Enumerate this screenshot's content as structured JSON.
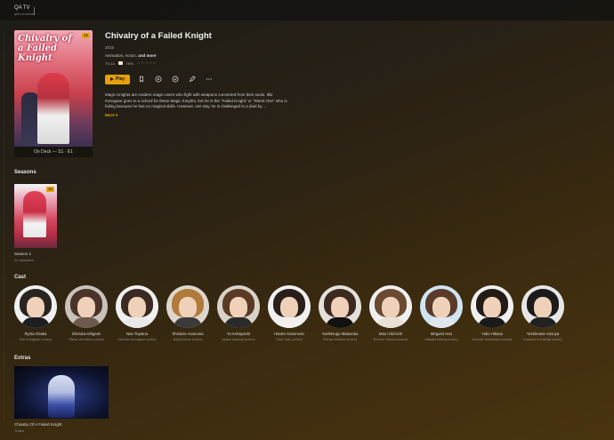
{
  "topbar": {
    "server_name": "QA TV",
    "server_sub": "plex.tv.server"
  },
  "show": {
    "title": "Chivalry of a Failed Knight",
    "year": "2015",
    "genres_prefix": "Animation, Action, ",
    "genres_more": "and more",
    "content_rating": "TV-14",
    "audience_score": "79%",
    "stars": "☆☆☆☆☆",
    "poster_title": "Chivalry of a Failed Knight",
    "poster_badge": "10",
    "on_deck": "On Deck — S1 · E1",
    "summary": "Magic Knights are modern magic-users who fight with weapons converted from their souls. Ikki Kurogane goes to a school for these Magic Knights, but he is the \"Failed Knight\" or \"Worst One\" who is failing because he has no magical skills. However, one day, he is challenged to a duel by ...",
    "more_label": "More ▾"
  },
  "actions": {
    "play_label": "Play"
  },
  "sections": {
    "seasons": "Seasons",
    "cast": "Cast",
    "extras": "Extras"
  },
  "season": {
    "name": "Season 1",
    "episodes": "12 episodes",
    "badge": "12"
  },
  "cast": [
    {
      "name": "Ryota Osaka",
      "role": "Ikki Kurogane (voice)"
    },
    {
      "name": "Shizuka Ishigami",
      "role": "Stella Vermillion (voice)"
    },
    {
      "name": "Nao Toyama",
      "role": "Shizuku Kurogane (voice)"
    },
    {
      "name": "Shintaro Asanuma",
      "role": "Nagi Arisuin (voice)"
    },
    {
      "name": "Yu Kobayashi",
      "role": "Ayase Ayatsuji (voice)"
    },
    {
      "name": "Hisako Kanemoto",
      "role": "Toka Todo (voice)"
    },
    {
      "name": "Yoshitsugu Matsuoka",
      "role": "Shinya Kiribara (voice)"
    },
    {
      "name": "Mao Ichimichi",
      "role": "Renren Tomaru (voice)"
    },
    {
      "name": "Megumi Han",
      "role": "Utakata Misogi (voice)"
    },
    {
      "name": "Yoko Hikasa",
      "role": "Kanata Totokubara (voice)"
    },
    {
      "name": "Yoshimasa Hosoya",
      "role": "Kuraudo Kurashiki (voice)"
    }
  ],
  "extra": {
    "name": "Chivalry Of A Failed Knight",
    "type": "Trailer"
  },
  "colors": {
    "accent": "#e5a00d"
  }
}
